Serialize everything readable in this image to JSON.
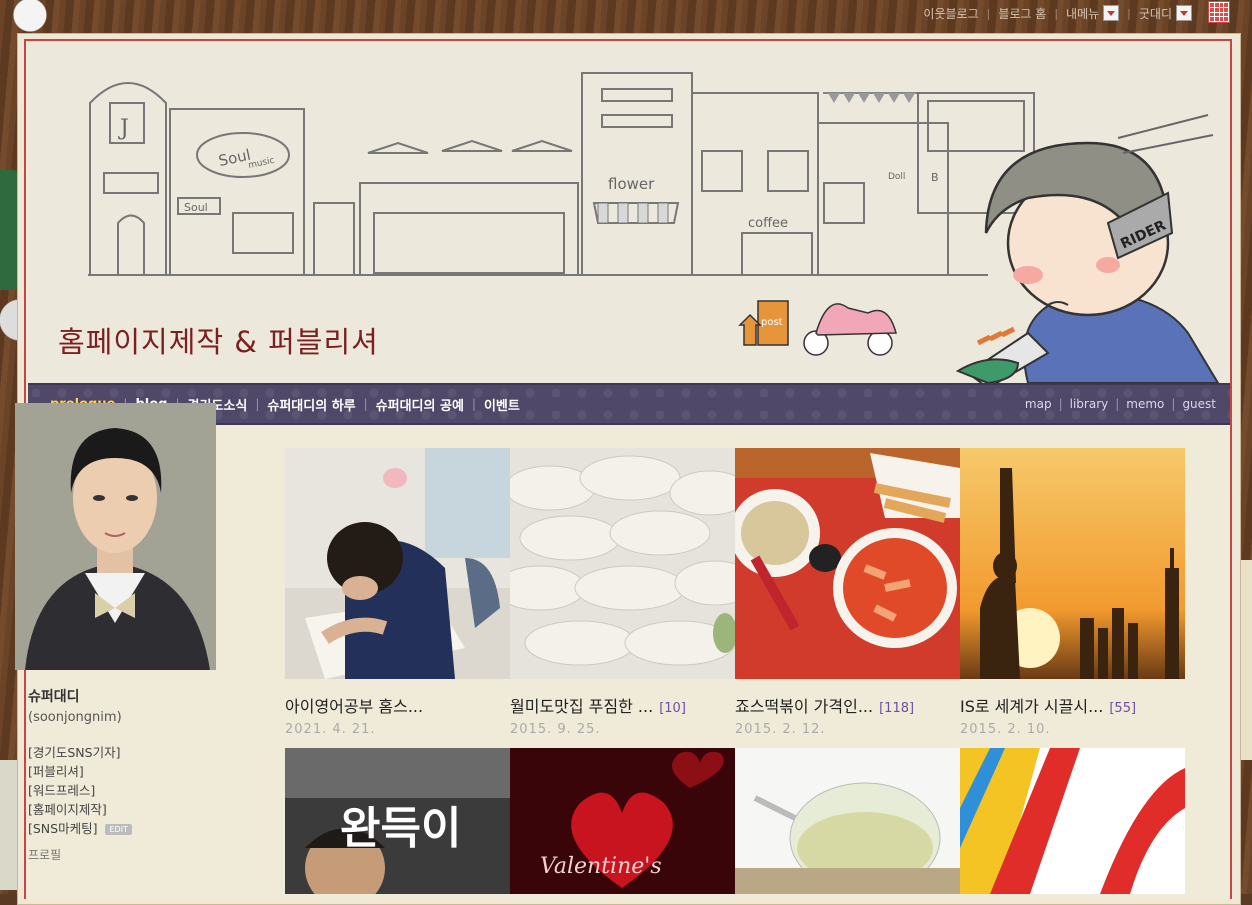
{
  "topbar": {
    "links": [
      "이웃블로그",
      "블로그 홈",
      "내메뉴",
      "굿대디"
    ]
  },
  "blog": {
    "title": "홈페이지제작 & 퍼블리셔"
  },
  "nav": {
    "left": [
      "prologue",
      "blog",
      "경기도소식",
      "슈퍼대디의 하루",
      "슈퍼대디의 공예",
      "이벤트"
    ],
    "right": [
      "map",
      "library",
      "memo",
      "guest"
    ]
  },
  "profile": {
    "name": "슈퍼대디",
    "id": "(soonjongnim)",
    "tags": [
      "[경기도SNS기자]",
      "[퍼블리셔]",
      "[워드프레스]",
      "[홈페이지제작]",
      "[SNS마케팅]"
    ],
    "edit": "EDIT",
    "link": "프로필"
  },
  "posts": [
    {
      "title": "아이영어공부 홈스...",
      "count": "",
      "date": "2021. 4. 21."
    },
    {
      "title": "월미도맛집 푸짐한 ...",
      "count": "[10]",
      "date": "2015. 9. 25."
    },
    {
      "title": "죠스떡볶이 가격인...",
      "count": "[118]",
      "date": "2015. 2. 12."
    },
    {
      "title": "IS로 세계가 시끌시...",
      "count": "[55]",
      "date": "2015. 2. 10."
    }
  ],
  "posts_row2_text": {
    "movie": "완득이",
    "valentine": "Valentine's"
  },
  "header_art": {
    "signs": [
      "J",
      "Soul",
      "music",
      "flower",
      "coffee",
      "Doll",
      "B",
      "RIDER",
      "post"
    ]
  }
}
